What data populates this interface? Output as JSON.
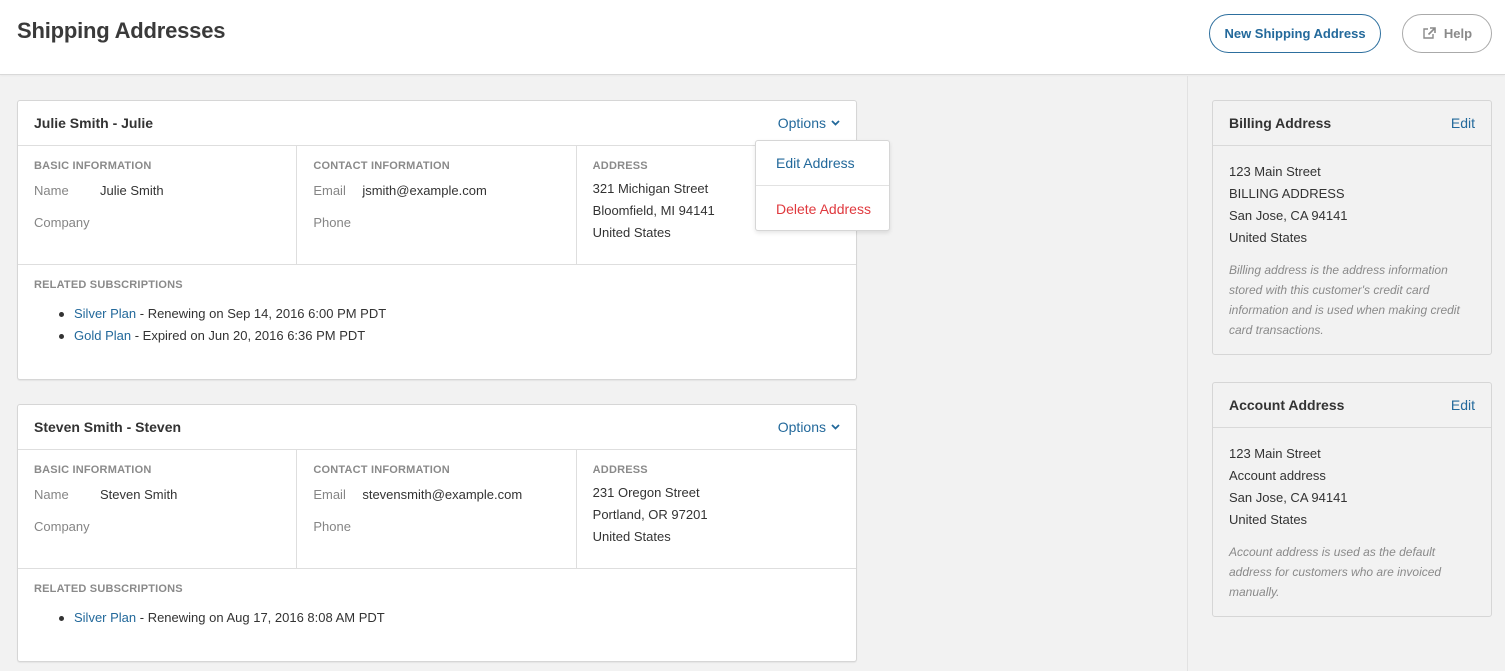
{
  "header": {
    "title": "Shipping Addresses",
    "new_button": "New Shipping Address",
    "help_button": "Help",
    "help_icon": "external-link-icon"
  },
  "labels": {
    "basic_information": "BASIC INFORMATION",
    "contact_information": "CONTACT INFORMATION",
    "address": "ADDRESS",
    "related_subscriptions": "RELATED SUBSCRIPTIONS",
    "name": "Name",
    "company": "Company",
    "email": "Email",
    "phone": "Phone",
    "options": "Options"
  },
  "dropdown": {
    "edit": "Edit Address",
    "delete": "Delete Address"
  },
  "addresses": [
    {
      "title": "Julie Smith - Julie",
      "name": "Julie Smith",
      "company": "",
      "email": "jsmith@example.com",
      "phone": "",
      "address_lines": [
        "321 Michigan Street",
        "Bloomfield, MI 94141",
        "United States"
      ],
      "subscriptions": [
        {
          "plan": "Silver Plan",
          "status": " - Renewing on Sep 14, 2016 6:00 PM PDT"
        },
        {
          "plan": "Gold Plan",
          "status": " - Expired on Jun 20, 2016 6:36 PM PDT"
        }
      ]
    },
    {
      "title": "Steven Smith - Steven",
      "name": "Steven Smith",
      "company": "",
      "email": "stevensmith@example.com",
      "phone": "",
      "address_lines": [
        "231 Oregon Street",
        "Portland, OR 97201",
        "United States"
      ],
      "subscriptions": [
        {
          "plan": "Silver Plan",
          "status": " - Renewing on Aug 17, 2016 8:08 AM PDT"
        }
      ]
    }
  ],
  "sidebar": {
    "billing": {
      "title": "Billing Address",
      "edit": "Edit",
      "lines": [
        "123 Main Street",
        "BILLING ADDRESS",
        "San Jose, CA 94141",
        "United States"
      ],
      "note": "Billing address is the address information stored with this customer's credit card information and is used when making credit card transactions."
    },
    "account": {
      "title": "Account Address",
      "edit": "Edit",
      "lines": [
        "123 Main Street",
        "Account address",
        "San Jose, CA 94141",
        "United States"
      ],
      "note": "Account address is used as the default address for customers who are invoiced manually."
    }
  },
  "colors": {
    "link": "#23699b",
    "danger": "#e0393e",
    "background": "#f2f2f2"
  }
}
